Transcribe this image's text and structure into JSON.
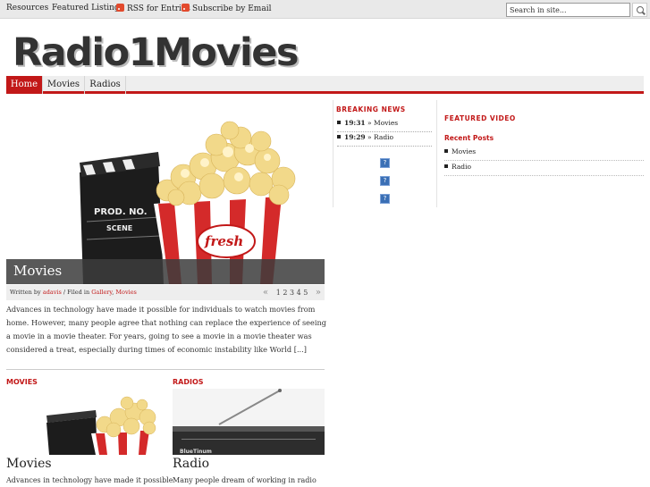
{
  "topbar": {
    "links": [
      "Resources",
      "Featured Listings"
    ],
    "rss_entries": "RSS for Entries",
    "subscribe_email": "Subscribe by Email",
    "search_placeholder": "Search in site..."
  },
  "logo": {
    "text": "Radio1Movies"
  },
  "nav": {
    "tabs": [
      "Home",
      "Movies",
      "Radios"
    ],
    "active": "Home"
  },
  "featured": {
    "title": "Movies",
    "meta": {
      "written_by_label": "Written by",
      "author": "adavis",
      "filed_label": "Filed in",
      "categories": [
        "Gallery",
        "Movies"
      ]
    },
    "pager": {
      "prev": "«",
      "pages": "1 2 3 4 5",
      "next": "»"
    },
    "excerpt": "Advances in technology have made it possible for individuals to watch movies from home. However, many people agree that nothing can replace the experience of seeing a movie in a movie theater. For years, going to see a movie in a movie theater was considered a treat, especially during times of economic instability like World [...]",
    "image_text": {
      "clapper_label": "PROD. NO.",
      "clapper_sub": "SCENE",
      "popcorn_label": "fresh"
    }
  },
  "categories": [
    {
      "heading": "MOVIES",
      "post_title": "Movies",
      "excerpt": "Advances in technology have made it possible"
    },
    {
      "heading": "RADIOS",
      "post_title": "Radio",
      "excerpt": "Many people dream of working in radio",
      "image_text": "BlueTinum"
    }
  ],
  "breaking_news": {
    "heading": "BREAKING NEWS",
    "items": [
      {
        "time": "19:31",
        "sep": "»",
        "label": "Movies"
      },
      {
        "time": "19:29",
        "sep": "»",
        "label": "Radio"
      }
    ],
    "icons": [
      "?",
      "?",
      "?"
    ]
  },
  "sidebar": {
    "featured_video_heading": "FEATURED VIDEO",
    "recent_posts_heading": "Recent Posts",
    "recent_posts": [
      "Movies",
      "Radio"
    ]
  },
  "colors": {
    "accent": "#c21818",
    "nav_bg": "#eeeeee",
    "topbar_bg": "#e9e9e9"
  }
}
